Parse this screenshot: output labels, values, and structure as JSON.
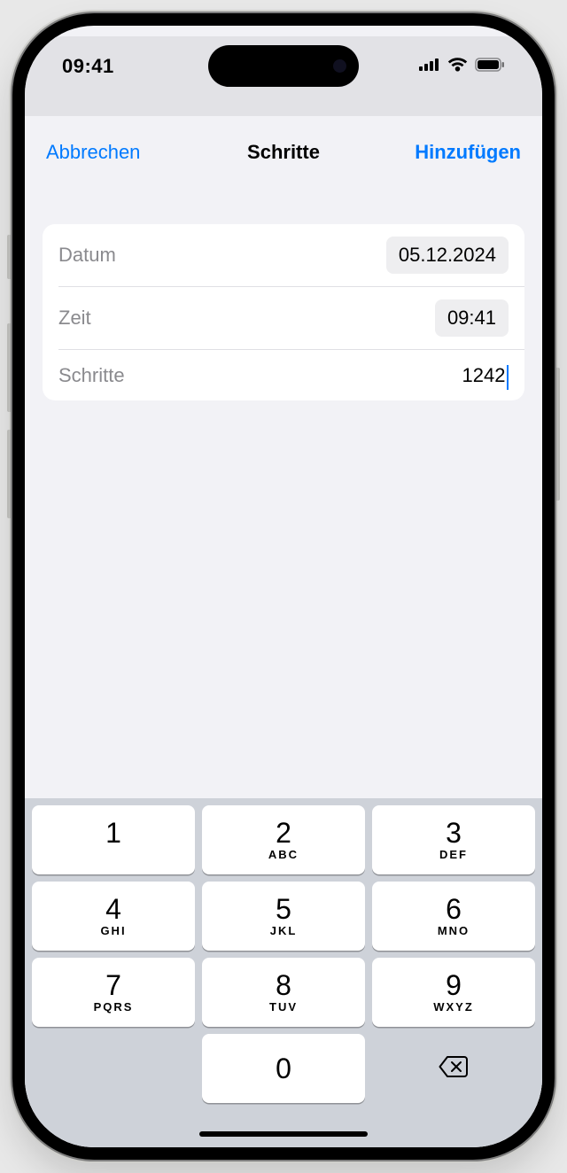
{
  "status": {
    "time": "09:41"
  },
  "nav": {
    "cancel_label": "Abbrechen",
    "title": "Schritte",
    "add_label": "Hinzufügen"
  },
  "form": {
    "date": {
      "label": "Datum",
      "value": "05.12.2024"
    },
    "time": {
      "label": "Zeit",
      "value": "09:41"
    },
    "steps": {
      "label": "Schritte",
      "value": "1242"
    }
  },
  "keypad": {
    "keys": [
      [
        {
          "d": "1",
          "l": ""
        },
        {
          "d": "2",
          "l": "ABC"
        },
        {
          "d": "3",
          "l": "DEF"
        }
      ],
      [
        {
          "d": "4",
          "l": "GHI"
        },
        {
          "d": "5",
          "l": "JKL"
        },
        {
          "d": "6",
          "l": "MNO"
        }
      ],
      [
        {
          "d": "7",
          "l": "PQRS"
        },
        {
          "d": "8",
          "l": "TUV"
        },
        {
          "d": "9",
          "l": "WXYZ"
        }
      ],
      [
        {
          "d": "",
          "l": ""
        },
        {
          "d": "0",
          "l": ""
        },
        {
          "d": "del",
          "l": ""
        }
      ]
    ]
  }
}
